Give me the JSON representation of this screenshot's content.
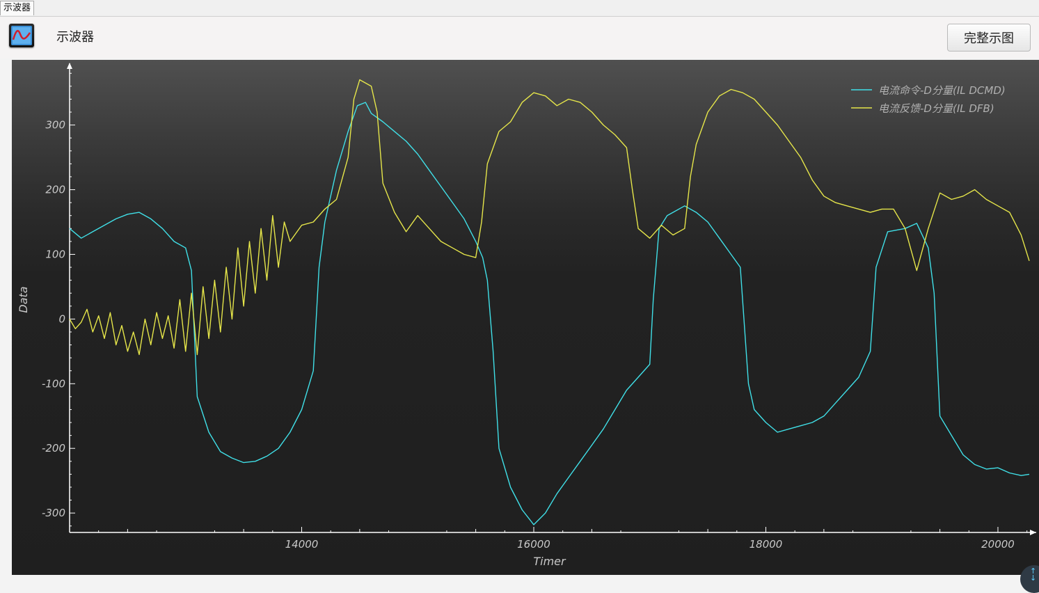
{
  "tab": {
    "label": "示波器"
  },
  "header": {
    "title": "示波器",
    "icon": "oscilloscope-icon",
    "full_view_label": "完整示图"
  },
  "colors": {
    "series_dcmd": "#40e0e8",
    "series_dfb": "#e6e64a",
    "axis": "#ffffff",
    "text": "#c8c8c8"
  },
  "chart_data": {
    "type": "line",
    "xlabel": "Timer",
    "ylabel": "Data",
    "xlim": [
      12000,
      20270
    ],
    "ylim": [
      -330,
      390
    ],
    "x_ticks": [
      14000,
      16000,
      18000,
      20000
    ],
    "y_ticks": [
      -300,
      -200,
      -100,
      0,
      100,
      200,
      300
    ],
    "x_tick_labels": [
      "14000",
      "16000",
      "18000",
      "20000"
    ],
    "y_tick_labels": [
      "-300",
      "-200",
      "-100",
      "0",
      "100",
      "200",
      "300"
    ],
    "grid": false,
    "legend": "top-right",
    "series": [
      {
        "name": "电流命令-D分量(IL DCMD)",
        "color": "#40e0e8",
        "points": [
          [
            12000,
            140
          ],
          [
            12100,
            125
          ],
          [
            12200,
            135
          ],
          [
            12300,
            145
          ],
          [
            12400,
            155
          ],
          [
            12500,
            162
          ],
          [
            12600,
            165
          ],
          [
            12700,
            155
          ],
          [
            12800,
            140
          ],
          [
            12900,
            120
          ],
          [
            13000,
            110
          ],
          [
            13050,
            75
          ],
          [
            13100,
            -120
          ],
          [
            13200,
            -175
          ],
          [
            13300,
            -205
          ],
          [
            13400,
            -215
          ],
          [
            13500,
            -222
          ],
          [
            13600,
            -220
          ],
          [
            13700,
            -212
          ],
          [
            13800,
            -200
          ],
          [
            13900,
            -175
          ],
          [
            14000,
            -140
          ],
          [
            14100,
            -80
          ],
          [
            14150,
            80
          ],
          [
            14200,
            150
          ],
          [
            14300,
            230
          ],
          [
            14400,
            290
          ],
          [
            14480,
            330
          ],
          [
            14550,
            335
          ],
          [
            14600,
            318
          ],
          [
            14700,
            305
          ],
          [
            14800,
            290
          ],
          [
            14900,
            275
          ],
          [
            15000,
            255
          ],
          [
            15100,
            230
          ],
          [
            15200,
            205
          ],
          [
            15300,
            180
          ],
          [
            15400,
            155
          ],
          [
            15500,
            120
          ],
          [
            15560,
            95
          ],
          [
            15600,
            60
          ],
          [
            15650,
            -50
          ],
          [
            15700,
            -200
          ],
          [
            15800,
            -260
          ],
          [
            15900,
            -295
          ],
          [
            16000,
            -318
          ],
          [
            16100,
            -300
          ],
          [
            16200,
            -270
          ],
          [
            16300,
            -245
          ],
          [
            16400,
            -220
          ],
          [
            16500,
            -195
          ],
          [
            16600,
            -170
          ],
          [
            16700,
            -140
          ],
          [
            16800,
            -110
          ],
          [
            16900,
            -90
          ],
          [
            17000,
            -70
          ],
          [
            17030,
            30
          ],
          [
            17080,
            140
          ],
          [
            17150,
            160
          ],
          [
            17200,
            165
          ],
          [
            17300,
            175
          ],
          [
            17400,
            165
          ],
          [
            17500,
            150
          ],
          [
            17600,
            125
          ],
          [
            17700,
            100
          ],
          [
            17780,
            80
          ],
          [
            17850,
            -100
          ],
          [
            17900,
            -140
          ],
          [
            18000,
            -160
          ],
          [
            18100,
            -175
          ],
          [
            18200,
            -170
          ],
          [
            18300,
            -165
          ],
          [
            18400,
            -160
          ],
          [
            18500,
            -150
          ],
          [
            18600,
            -130
          ],
          [
            18700,
            -110
          ],
          [
            18800,
            -90
          ],
          [
            18900,
            -50
          ],
          [
            18950,
            80
          ],
          [
            19050,
            135
          ],
          [
            19200,
            140
          ],
          [
            19300,
            148
          ],
          [
            19400,
            110
          ],
          [
            19450,
            40
          ],
          [
            19500,
            -150
          ],
          [
            19600,
            -180
          ],
          [
            19700,
            -210
          ],
          [
            19800,
            -225
          ],
          [
            19900,
            -232
          ],
          [
            20000,
            -230
          ],
          [
            20100,
            -238
          ],
          [
            20200,
            -242
          ],
          [
            20270,
            -240
          ]
        ]
      },
      {
        "name": "电流反馈-D分量(IL DFB)",
        "color": "#e6e64a",
        "points": [
          [
            12000,
            0
          ],
          [
            12050,
            -15
          ],
          [
            12100,
            -5
          ],
          [
            12150,
            15
          ],
          [
            12200,
            -20
          ],
          [
            12250,
            5
          ],
          [
            12300,
            -30
          ],
          [
            12350,
            10
          ],
          [
            12400,
            -40
          ],
          [
            12450,
            -10
          ],
          [
            12500,
            -50
          ],
          [
            12550,
            -20
          ],
          [
            12600,
            -55
          ],
          [
            12650,
            0
          ],
          [
            12700,
            -40
          ],
          [
            12750,
            10
          ],
          [
            12800,
            -30
          ],
          [
            12850,
            5
          ],
          [
            12900,
            -45
          ],
          [
            12950,
            30
          ],
          [
            13000,
            -50
          ],
          [
            13050,
            40
          ],
          [
            13100,
            -55
          ],
          [
            13150,
            50
          ],
          [
            13200,
            -30
          ],
          [
            13250,
            60
          ],
          [
            13300,
            -20
          ],
          [
            13350,
            80
          ],
          [
            13400,
            0
          ],
          [
            13450,
            110
          ],
          [
            13500,
            20
          ],
          [
            13550,
            120
          ],
          [
            13600,
            40
          ],
          [
            13650,
            140
          ],
          [
            13700,
            60
          ],
          [
            13750,
            160
          ],
          [
            13800,
            80
          ],
          [
            13850,
            150
          ],
          [
            13900,
            120
          ],
          [
            14000,
            145
          ],
          [
            14100,
            150
          ],
          [
            14200,
            170
          ],
          [
            14300,
            185
          ],
          [
            14400,
            250
          ],
          [
            14450,
            340
          ],
          [
            14500,
            370
          ],
          [
            14600,
            360
          ],
          [
            14650,
            320
          ],
          [
            14700,
            210
          ],
          [
            14800,
            165
          ],
          [
            14900,
            135
          ],
          [
            15000,
            160
          ],
          [
            15100,
            140
          ],
          [
            15200,
            120
          ],
          [
            15300,
            110
          ],
          [
            15400,
            100
          ],
          [
            15500,
            95
          ],
          [
            15550,
            150
          ],
          [
            15600,
            240
          ],
          [
            15700,
            290
          ],
          [
            15800,
            305
          ],
          [
            15900,
            335
          ],
          [
            16000,
            350
          ],
          [
            16100,
            345
          ],
          [
            16200,
            330
          ],
          [
            16300,
            340
          ],
          [
            16400,
            335
          ],
          [
            16500,
            320
          ],
          [
            16600,
            300
          ],
          [
            16700,
            285
          ],
          [
            16800,
            265
          ],
          [
            16850,
            200
          ],
          [
            16900,
            140
          ],
          [
            17000,
            125
          ],
          [
            17100,
            145
          ],
          [
            17200,
            130
          ],
          [
            17300,
            140
          ],
          [
            17350,
            220
          ],
          [
            17400,
            270
          ],
          [
            17500,
            320
          ],
          [
            17600,
            345
          ],
          [
            17700,
            355
          ],
          [
            17800,
            350
          ],
          [
            17900,
            340
          ],
          [
            18000,
            320
          ],
          [
            18100,
            300
          ],
          [
            18200,
            275
          ],
          [
            18300,
            250
          ],
          [
            18400,
            215
          ],
          [
            18500,
            190
          ],
          [
            18600,
            180
          ],
          [
            18700,
            175
          ],
          [
            18800,
            170
          ],
          [
            18900,
            165
          ],
          [
            19000,
            170
          ],
          [
            19100,
            170
          ],
          [
            19200,
            140
          ],
          [
            19300,
            75
          ],
          [
            19400,
            140
          ],
          [
            19500,
            195
          ],
          [
            19600,
            185
          ],
          [
            19700,
            190
          ],
          [
            19800,
            200
          ],
          [
            19900,
            185
          ],
          [
            20000,
            175
          ],
          [
            20100,
            165
          ],
          [
            20200,
            130
          ],
          [
            20270,
            90
          ]
        ]
      }
    ]
  }
}
